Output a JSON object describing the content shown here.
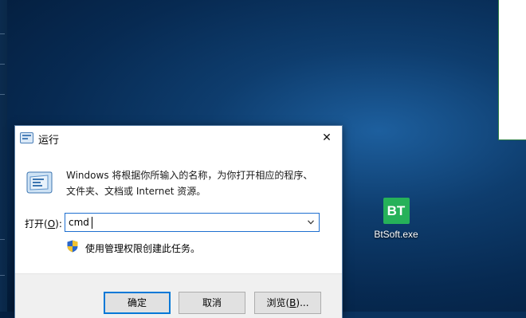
{
  "desktop": {
    "icon": {
      "tile_text": "BT",
      "label": "BtSoft.exe",
      "color": "#26b159"
    }
  },
  "dialog": {
    "title": "运行",
    "close_glyph": "✕",
    "description_line1": "Windows 将根据你所输入的名称，为你打开相应的程序、",
    "description_line2": "文件夹、文档或 Internet 资源。",
    "open_label_prefix": "打开(",
    "open_label_key": "O",
    "open_label_suffix": "):",
    "input_value": "cmd",
    "admin_note": "使用管理权限创建此任务。",
    "buttons": {
      "ok": "确定",
      "cancel": "取消",
      "browse_prefix": "浏览(",
      "browse_key": "B",
      "browse_suffix": ")..."
    },
    "accent_color": "#0078d7"
  }
}
